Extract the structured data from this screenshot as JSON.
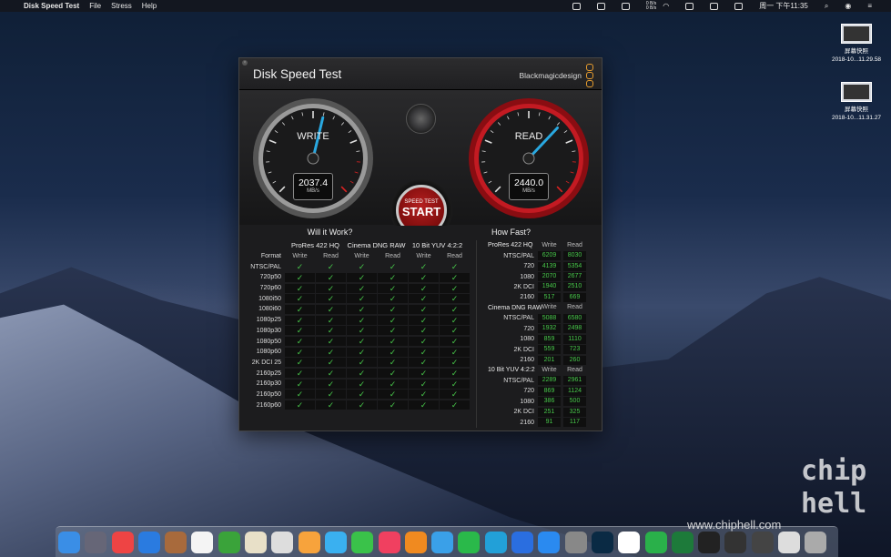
{
  "menubar": {
    "app": "Disk Speed Test",
    "items": [
      "File",
      "Stress",
      "Help"
    ],
    "clock": "周一 下午11:35",
    "net_up": "0 B/s",
    "net_down": "0 B/s"
  },
  "desktop": {
    "icons": [
      {
        "label": "屏幕快照",
        "sub": "2018-10...11.29.58"
      },
      {
        "label": "屏幕快照",
        "sub": "2018-10...11.31.27"
      }
    ]
  },
  "window": {
    "title": "Disk Speed Test",
    "brand": "Blackmagicdesign",
    "write": {
      "label": "WRITE",
      "value": "2037.4",
      "unit": "MB/s",
      "fraction": 0.55
    },
    "read": {
      "label": "READ",
      "value": "2440.0",
      "unit": "MB/s",
      "fraction": 0.66
    },
    "start": {
      "top": "SPEED TEST",
      "label": "START"
    },
    "will_it_work": "Will it Work?",
    "how_fast": "How Fast?",
    "codecs": [
      "ProRes 422 HQ",
      "Cinema DNG RAW",
      "10 Bit YUV 4:2:2"
    ],
    "format_label": "Format",
    "write_label": "Write",
    "read_label": "Read",
    "formats": [
      "NTSC/PAL",
      "720p50",
      "720p60",
      "1080i50",
      "1080i60",
      "1080p25",
      "1080p30",
      "1080p50",
      "1080p60",
      "2K DCI 25",
      "2160p25",
      "2160p30",
      "2160p50",
      "2160p60"
    ],
    "check": "✓",
    "howfast": [
      {
        "codec": "ProRes 422 HQ",
        "rows": [
          {
            "f": "NTSC/PAL",
            "w": "6209",
            "r": "8030"
          },
          {
            "f": "720",
            "w": "4139",
            "r": "5354"
          },
          {
            "f": "1080",
            "w": "2070",
            "r": "2677"
          },
          {
            "f": "2K DCI",
            "w": "1940",
            "r": "2510"
          },
          {
            "f": "2160",
            "w": "517",
            "r": "669"
          }
        ]
      },
      {
        "codec": "Cinema DNG RAW",
        "rows": [
          {
            "f": "NTSC/PAL",
            "w": "5088",
            "r": "6580"
          },
          {
            "f": "720",
            "w": "1932",
            "r": "2498"
          },
          {
            "f": "1080",
            "w": "859",
            "r": "1110"
          },
          {
            "f": "2K DCI",
            "w": "559",
            "r": "723"
          },
          {
            "f": "2160",
            "w": "201",
            "r": "260"
          }
        ]
      },
      {
        "codec": "10 Bit YUV 4:2:2",
        "rows": [
          {
            "f": "NTSC/PAL",
            "w": "2289",
            "r": "2961"
          },
          {
            "f": "720",
            "w": "869",
            "r": "1124"
          },
          {
            "f": "1080",
            "w": "386",
            "r": "500"
          },
          {
            "f": "2K DCI",
            "w": "251",
            "r": "325"
          },
          {
            "f": "2160",
            "w": "91",
            "r": "117"
          }
        ]
      }
    ]
  },
  "dock": [
    {
      "name": "finder",
      "c": "#3a8ee6"
    },
    {
      "name": "launchpad",
      "c": "#667"
    },
    {
      "name": "chrome",
      "c": "#e44"
    },
    {
      "name": "appstore-a",
      "c": "#2a7be0"
    },
    {
      "name": "notes",
      "c": "#a86a3c"
    },
    {
      "name": "calendar",
      "c": "#f4f4f4"
    },
    {
      "name": "evernote",
      "c": "#3aa33a"
    },
    {
      "name": "contacts",
      "c": "#e8e0c8"
    },
    {
      "name": "preview",
      "c": "#ddd"
    },
    {
      "name": "photos",
      "c": "#f7a33c"
    },
    {
      "name": "messages",
      "c": "#3ab0f0"
    },
    {
      "name": "facetime",
      "c": "#3ac24a"
    },
    {
      "name": "music",
      "c": "#f04060"
    },
    {
      "name": "books",
      "c": "#f08a20"
    },
    {
      "name": "qq",
      "c": "#3aa0e8"
    },
    {
      "name": "wechat",
      "c": "#2ab94a"
    },
    {
      "name": "tencent",
      "c": "#22a0d8"
    },
    {
      "name": "1password",
      "c": "#2a6ee0"
    },
    {
      "name": "appstore",
      "c": "#2a8af0"
    },
    {
      "name": "prefs",
      "c": "#888"
    },
    {
      "name": "photoshop",
      "c": "#0a2a44"
    },
    {
      "name": "app-x",
      "c": "#fff"
    },
    {
      "name": "xmind",
      "c": "#2ab04a"
    },
    {
      "name": "excel",
      "c": "#1d7a3a"
    },
    {
      "name": "terminal",
      "c": "#222"
    },
    {
      "name": "unity",
      "c": "#333"
    },
    {
      "name": "diskspeed",
      "c": "#444"
    },
    {
      "name": "file",
      "c": "#ddd"
    },
    {
      "name": "trash",
      "c": "#aaa"
    }
  ],
  "watermark": "www.chiphell.com",
  "wm_logo": "chip hell"
}
